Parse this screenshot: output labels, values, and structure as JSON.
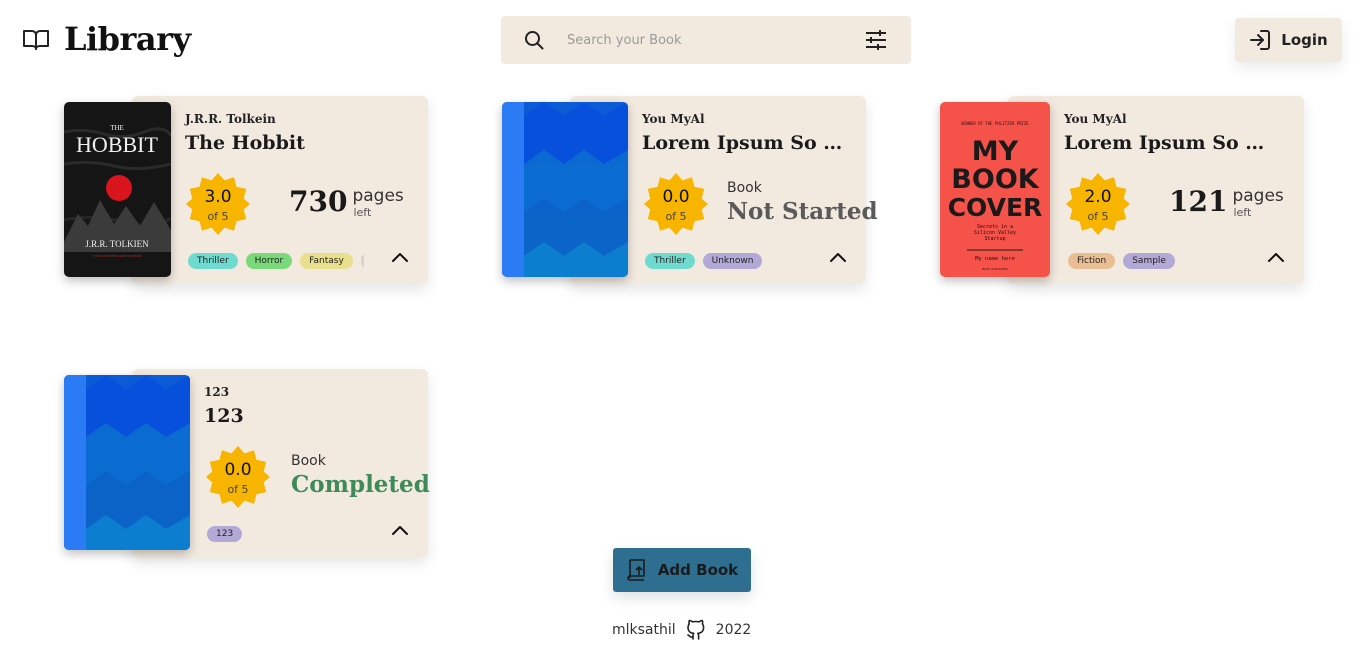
{
  "header": {
    "logo_text": "Library",
    "search_placeholder": "Search your Book",
    "login_label": "Login"
  },
  "books": [
    {
      "author": "J.R.R. Tolkein",
      "title": "The Hobbit",
      "rating": "3.0",
      "rating_of": "of 5",
      "pages_num": "730",
      "pages_label": "pages",
      "pages_sub": "left",
      "cover": {
        "top": "THE",
        "title": "HOBBIT",
        "author": "J.R.R. TOLKIEN",
        "sub": "75TH ANNIVERSARY EDITION"
      },
      "tags": [
        {
          "label": "Thriller",
          "color": "#6fdbd0"
        },
        {
          "label": "Horror",
          "color": "#7ad97a"
        },
        {
          "label": "Fantasy",
          "color": "#e8e08c"
        }
      ]
    },
    {
      "author": "You MyAl",
      "title": "Lorem Ipsum So Sorry",
      "rating": "0.0",
      "rating_of": "of 5",
      "status_label": "Book",
      "status_value": "Not Started",
      "status_color": "#5a5a5a",
      "tags": [
        {
          "label": "Thriller",
          "color": "#6fdbd0"
        },
        {
          "label": "Unknown",
          "color": "#b3a9d6"
        }
      ]
    },
    {
      "author": "You MyAl",
      "title": "Lorem Ipsum So Sorry",
      "rating": "2.0",
      "rating_of": "of 5",
      "pages_num": "121",
      "pages_label": "pages",
      "pages_sub": "left",
      "cover": {
        "top": "WINNER OF THE PULITZER PRIZE",
        "l1": "MY",
        "l2": "BOOK",
        "l3": "COVER",
        "sub1": "Secrets in a",
        "sub2": "Silicon Valley",
        "sub3": "Startup",
        "name": "My name here",
        "foot": "BOOK PUBLISHER"
      },
      "tags": [
        {
          "label": "Fiction",
          "color": "#e9be92"
        },
        {
          "label": "Sample",
          "color": "#b3a9d6"
        }
      ]
    },
    {
      "author": "123",
      "title": "123",
      "rating": "0.0",
      "rating_of": "of 5",
      "status_label": "Book",
      "status_value": "Completed",
      "status_color": "#3e8a58",
      "tags": [
        {
          "label": "123",
          "color": "#b3a9d6"
        }
      ]
    }
  ],
  "add_book_label": "Add Book",
  "footer": {
    "author": "mlksathil",
    "year": "2022"
  },
  "icons": [
    "book-open-icon",
    "search-icon",
    "filter-sliders-icon",
    "login-icon",
    "chevron-up-icon",
    "upload-book-icon",
    "github-icon"
  ]
}
